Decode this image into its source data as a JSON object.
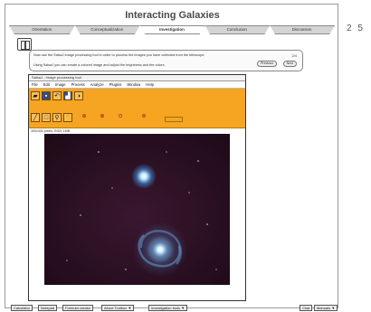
{
  "app": {
    "title": "Interacting Galaxies"
  },
  "tabs": [
    {
      "label": "Orientation",
      "active": false
    },
    {
      "label": "Conceptualization",
      "active": false
    },
    {
      "label": "Investigation",
      "active": true
    },
    {
      "label": "Conclusion",
      "active": false
    },
    {
      "label": "Discussion",
      "active": false
    }
  ],
  "page_number": "2 5",
  "instruction": {
    "line1": "Now use the SalsaJ image processing tool in order to process the images you have collected from the telescope.",
    "line2": "Using SalsaJ you can create a colored image and adjust the brightness and the colors.",
    "page": "2/4",
    "prev_label": "Previous",
    "next_label": "Next"
  },
  "tool_window": {
    "title": "SalsaJ - Image processing tool",
    "menu": [
      "File",
      "Edit",
      "Image",
      "Process",
      "Analyze",
      "Plugins",
      "Window",
      "Help"
    ],
    "status": "300x300 pixels; RGB; 1MB",
    "toolbar_icons": [
      "open-folder-icon",
      "save-icon",
      "undo-icon",
      "histogram-icon",
      "contrast-icon",
      "pencil-icon",
      "rectangle-select-icon",
      "magnifier-icon",
      "hand-icon",
      "plugin-a-icon",
      "plugin-b-icon",
      "plugin-c-icon",
      "plugin-d-icon"
    ]
  },
  "bottom_bar": {
    "calculator": "Calculator",
    "notepad": "Notepad",
    "formula_creator": "Formula creator",
    "about_toolbox": "About Toolbox ▼",
    "investigation_tools": "Investigation tools ▼",
    "chat": "Chat",
    "manuals": "Manuals ▼"
  }
}
